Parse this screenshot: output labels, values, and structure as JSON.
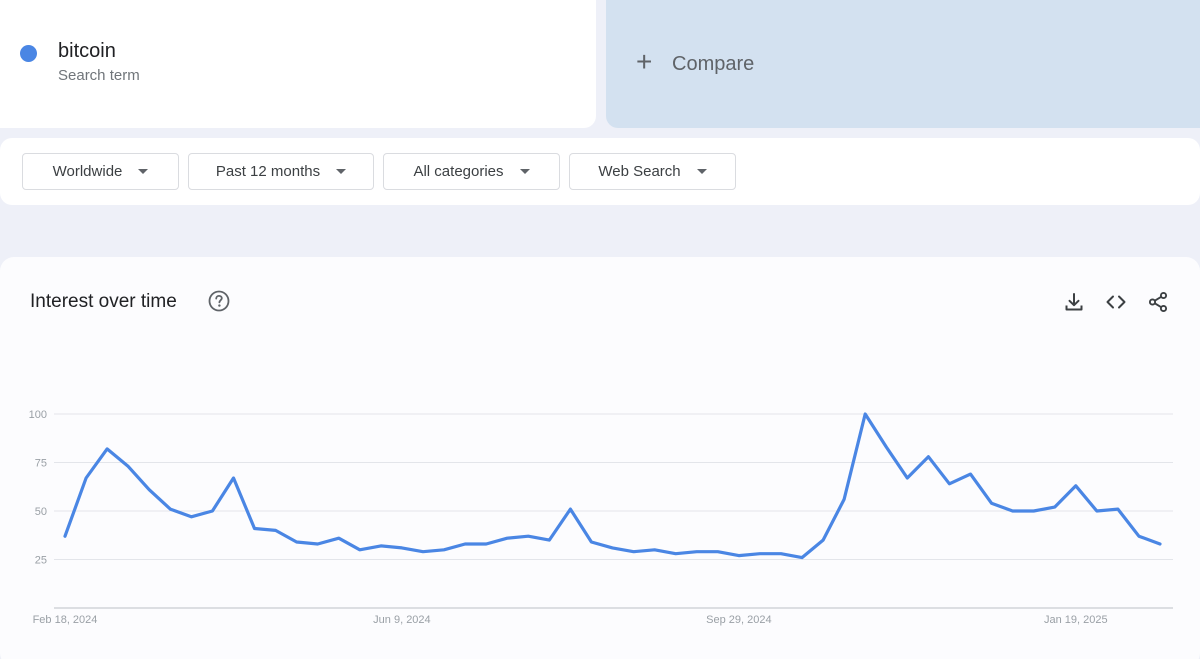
{
  "search_term": {
    "name": "bitcoin",
    "subtitle": "Search term",
    "color": "#4a86e4"
  },
  "compare": {
    "plus": "+",
    "label": "Compare"
  },
  "filters": {
    "region": "Worldwide",
    "time_range": "Past 12 months",
    "category": "All categories",
    "search_type": "Web Search"
  },
  "chart_section": {
    "title": "Interest over time",
    "icons": [
      "help-icon",
      "download-icon",
      "embed-icon",
      "share-icon"
    ]
  },
  "chart_data": {
    "type": "line",
    "title": "",
    "xlabel": "",
    "ylabel": "",
    "ylim": [
      0,
      100
    ],
    "yticks": [
      25,
      50,
      75,
      100
    ],
    "grid": true,
    "x_tick_labels": [
      {
        "label": "Feb 18, 2024",
        "index": 0
      },
      {
        "label": "Jun 9, 2024",
        "index": 16
      },
      {
        "label": "Sep 29, 2024",
        "index": 32
      },
      {
        "label": "Jan 19, 2025",
        "index": 48
      }
    ],
    "x": [
      "2024-02-18",
      "2024-02-25",
      "2024-03-03",
      "2024-03-10",
      "2024-03-17",
      "2024-03-24",
      "2024-03-31",
      "2024-04-07",
      "2024-04-14",
      "2024-04-21",
      "2024-04-28",
      "2024-05-05",
      "2024-05-12",
      "2024-05-19",
      "2024-05-26",
      "2024-06-02",
      "2024-06-09",
      "2024-06-16",
      "2024-06-23",
      "2024-06-30",
      "2024-07-07",
      "2024-07-14",
      "2024-07-21",
      "2024-07-28",
      "2024-08-04",
      "2024-08-11",
      "2024-08-18",
      "2024-08-25",
      "2024-09-01",
      "2024-09-08",
      "2024-09-15",
      "2024-09-22",
      "2024-09-29",
      "2024-10-06",
      "2024-10-13",
      "2024-10-20",
      "2024-10-27",
      "2024-11-03",
      "2024-11-10",
      "2024-11-17",
      "2024-11-24",
      "2024-12-01",
      "2024-12-08",
      "2024-12-15",
      "2024-12-22",
      "2024-12-29",
      "2025-01-05",
      "2025-01-12",
      "2025-01-19",
      "2025-01-26",
      "2025-02-02",
      "2025-02-09",
      "2025-02-16"
    ],
    "series": [
      {
        "name": "bitcoin",
        "color": "#4a86e4",
        "values": [
          37,
          67,
          82,
          73,
          61,
          51,
          47,
          50,
          67,
          41,
          40,
          34,
          33,
          36,
          30,
          32,
          31,
          29,
          30,
          33,
          33,
          36,
          37,
          35,
          51,
          34,
          31,
          29,
          30,
          28,
          29,
          29,
          27,
          28,
          28,
          26,
          35,
          56,
          100,
          83,
          67,
          78,
          64,
          69,
          54,
          50,
          50,
          52,
          63,
          50,
          51,
          37,
          33
        ]
      }
    ]
  }
}
